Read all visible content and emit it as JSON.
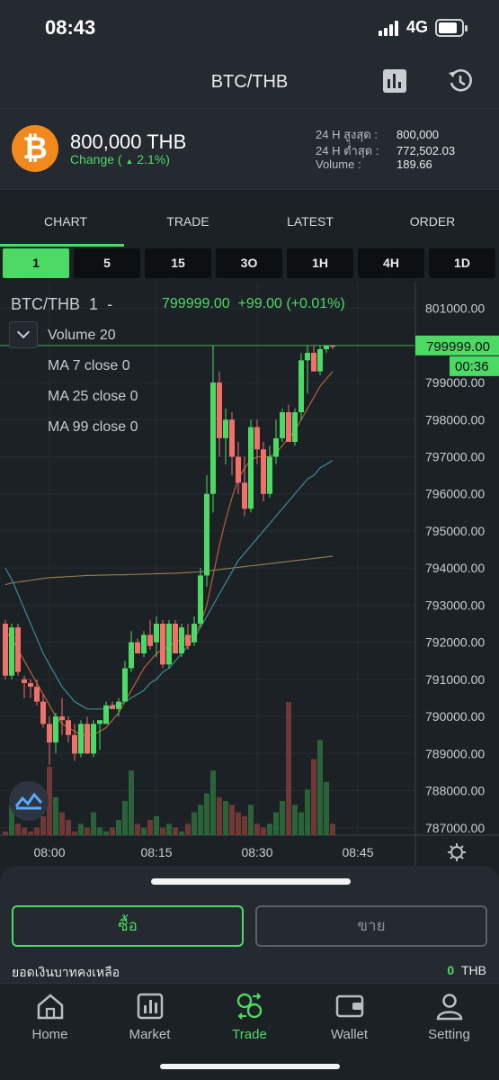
{
  "status": {
    "time": "08:43",
    "network": "4G"
  },
  "header": {
    "title": "BTC/THB"
  },
  "ticker": {
    "price": "800,000 THB",
    "change_prefix": "Change (",
    "change_value": "2.1%)",
    "change_arrow": "▲",
    "stats": [
      {
        "label": "24 H สูงสุด :",
        "value": "800,000"
      },
      {
        "label": "24 H ต่ำสุด :",
        "value": "772,502.03"
      },
      {
        "label": "Volume :",
        "value": "189.66"
      }
    ]
  },
  "tabs": [
    "CHART",
    "TRADE",
    "LATEST",
    "ORDER"
  ],
  "active_tab": "CHART",
  "intervals": [
    "1",
    "5",
    "15",
    "3O",
    "1H",
    "4H",
    "1D"
  ],
  "active_interval": "1",
  "chart_info": {
    "pair": "BTC/THB",
    "interval": "1",
    "dash": "-",
    "last": "799999.00",
    "change": "+99.00 (+0.01%)",
    "indicators": [
      "Volume 20",
      "MA 7 close 0",
      "MA 25 close 0",
      "MA 99 close 0"
    ],
    "current_price_tag": "799999.00",
    "countdown": "00:36"
  },
  "chart_data": {
    "type": "candlestick",
    "y_ticks": [
      "801000.00",
      "800000.00",
      "799000.00",
      "798000.00",
      "797000.00",
      "796000.00",
      "795000.00",
      "794000.00",
      "793000.00",
      "792000.00",
      "791000.00",
      "790000.00",
      "789000.00",
      "788000.00",
      "787000.00"
    ],
    "x_ticks": [
      "08:00",
      "08:15",
      "08:30",
      "08:45"
    ],
    "ylim": [
      786800,
      801500
    ],
    "candles": [
      [
        792500,
        792600,
        791000,
        791100
      ],
      [
        791100,
        792500,
        791000,
        792400
      ],
      [
        792400,
        792500,
        791100,
        791200
      ],
      [
        791000,
        791100,
        790500,
        790900
      ],
      [
        790900,
        791000,
        790500,
        790800
      ],
      [
        790800,
        791000,
        790300,
        790400
      ],
      [
        790400,
        790600,
        789700,
        789800
      ],
      [
        789800,
        790000,
        788700,
        789300
      ],
      [
        789300,
        790100,
        789000,
        790000
      ],
      [
        790000,
        790500,
        789500,
        789900
      ],
      [
        789900,
        790000,
        789300,
        789500
      ],
      [
        789500,
        789800,
        788800,
        789000
      ],
      [
        789000,
        789900,
        788900,
        789800
      ],
      [
        789800,
        790000,
        789000,
        789000
      ],
      [
        789000,
        789900,
        788900,
        789800
      ],
      [
        789800,
        789900,
        789100,
        789900
      ],
      [
        789800,
        790400,
        789800,
        790300
      ],
      [
        790300,
        790400,
        790200,
        790200
      ],
      [
        790200,
        790500,
        790000,
        790400
      ],
      [
        790400,
        791500,
        790400,
        791300
      ],
      [
        791300,
        792300,
        791200,
        792000
      ],
      [
        792000,
        792100,
        791700,
        791700
      ],
      [
        791700,
        792300,
        791600,
        792200
      ],
      [
        792200,
        792600,
        791800,
        791900
      ],
      [
        792000,
        792700,
        791600,
        792500
      ],
      [
        792500,
        792600,
        791300,
        791400
      ],
      [
        791400,
        792600,
        791300,
        792500
      ],
      [
        792500,
        792600,
        791700,
        791700
      ],
      [
        791700,
        792500,
        791600,
        792400
      ],
      [
        792200,
        792500,
        791800,
        791900
      ],
      [
        792000,
        792700,
        791900,
        792500
      ],
      [
        792500,
        794000,
        792400,
        793800
      ],
      [
        793800,
        796500,
        793500,
        796000
      ],
      [
        796000,
        800000,
        795500,
        799000
      ],
      [
        799000,
        799300,
        797000,
        797500
      ],
      [
        797500,
        798300,
        796800,
        798000
      ],
      [
        798000,
        798200,
        796500,
        797000
      ],
      [
        797000,
        797400,
        796000,
        796300
      ],
      [
        796300,
        797000,
        795400,
        795600
      ],
      [
        795600,
        798000,
        795500,
        797800
      ],
      [
        797800,
        798000,
        796800,
        797200
      ],
      [
        797200,
        797400,
        795800,
        796000
      ],
      [
        796000,
        797300,
        795900,
        797000
      ],
      [
        797000,
        798000,
        796800,
        797500
      ],
      [
        797500,
        798300,
        797400,
        798200
      ],
      [
        798200,
        798400,
        797400,
        797400
      ],
      [
        797400,
        798300,
        797300,
        798200
      ],
      [
        798200,
        799800,
        798000,
        799600
      ],
      [
        799600,
        800000,
        798700,
        799800
      ],
      [
        799800,
        800000,
        799300,
        799300
      ],
      [
        799300,
        800000,
        799200,
        799900
      ],
      [
        799900,
        800000,
        799800,
        800000
      ],
      [
        800000,
        800000,
        799900,
        799999
      ]
    ],
    "volumes": [
      1,
      8,
      3,
      2,
      1,
      2,
      5,
      18,
      10,
      6,
      4,
      1,
      3,
      2,
      6,
      2,
      1,
      2,
      4,
      9,
      17,
      3,
      2,
      4,
      5,
      2,
      3,
      2,
      1,
      3,
      6,
      8,
      11,
      17,
      10,
      9,
      8,
      6,
      5,
      8,
      3,
      2,
      3,
      6,
      9,
      35,
      8,
      6,
      12,
      20,
      25,
      14,
      3
    ],
    "ma7": [
      792300,
      792100,
      791800,
      791500,
      791200,
      790900,
      790600,
      790300,
      790000,
      789800,
      789700,
      789600,
      789500,
      789500,
      789500,
      789600,
      789700,
      789900,
      790100,
      790400,
      790700,
      791000,
      791300,
      791500,
      791700,
      791800,
      791900,
      792000,
      792100,
      792100,
      792200,
      792500,
      793000,
      793800,
      794600,
      795300,
      795900,
      796400,
      796700,
      796900,
      797000,
      797000,
      797000,
      797100,
      797300,
      797500,
      797700,
      798000,
      798300,
      798600,
      798900,
      799100,
      799300
    ],
    "ma25": [
      794000,
      793700,
      793300,
      792900,
      792500,
      792100,
      791700,
      791400,
      791100,
      790800,
      790600,
      790400,
      790300,
      790200,
      790200,
      790200,
      790200,
      790300,
      790300,
      790400,
      790500,
      790600,
      790700,
      790900,
      791000,
      791200,
      791300,
      791500,
      791700,
      791900,
      792100,
      792400,
      792700,
      793000,
      793300,
      793600,
      793900,
      794200,
      794400,
      794600,
      794800,
      795000,
      795200,
      795400,
      795600,
      795800,
      796000,
      796200,
      796400,
      796500,
      796700,
      796800,
      796900
    ],
    "ma99": [
      793550,
      793600,
      793620,
      793650,
      793670,
      793700,
      793720,
      793740,
      793750,
      793760,
      793770,
      793780,
      793790,
      793800,
      793800,
      793810,
      793810,
      793820,
      793820,
      793820,
      793830,
      793830,
      793840,
      793840,
      793850,
      793850,
      793860,
      793860,
      793870,
      793880,
      793890,
      793900,
      793920,
      793940,
      793960,
      793980,
      794000,
      794020,
      794040,
      794060,
      794080,
      794100,
      794120,
      794140,
      794160,
      794180,
      794200,
      794220,
      794240,
      794260,
      794280,
      794300,
      794320
    ]
  },
  "actions": {
    "buy": "ซื้อ",
    "sell": "ขาย"
  },
  "balance": {
    "label": "ยอดเงินบาทคงเหลือ",
    "amount": "0",
    "currency": "THB"
  },
  "tabbar": [
    {
      "label": "Home",
      "icon": "home-icon"
    },
    {
      "label": "Market",
      "icon": "market-icon"
    },
    {
      "label": "Trade",
      "icon": "trade-icon"
    },
    {
      "label": "Wallet",
      "icon": "wallet-icon"
    },
    {
      "label": "Setting",
      "icon": "user-icon"
    }
  ],
  "active_tabbar": "Trade",
  "colors": {
    "up": "#4cd964",
    "down": "#f0706a",
    "accent": "#4cd964",
    "btc": "#f2891d"
  }
}
